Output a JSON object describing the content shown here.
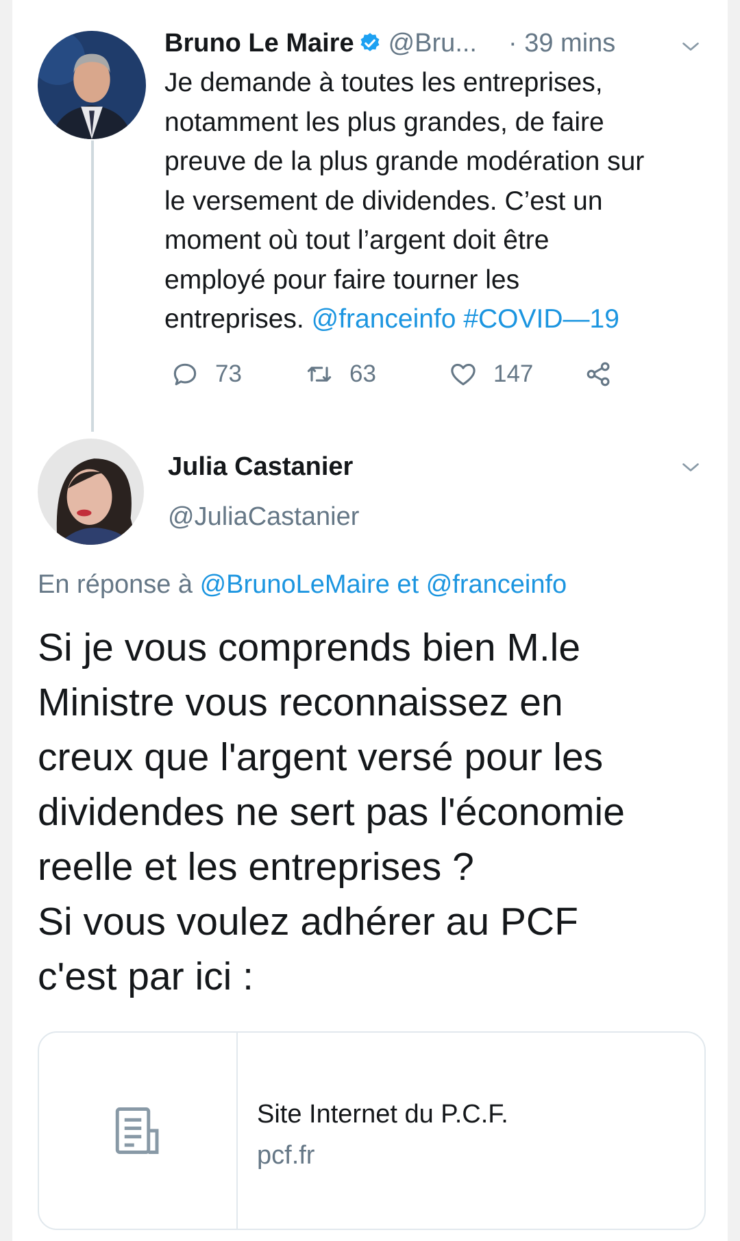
{
  "tweet1": {
    "author_name": "Bruno Le Maire",
    "author_handle": "@Bru...",
    "time": "· 39 mins",
    "body_lines": [
      "Je demande à toutes les entreprises,",
      "notamment les plus grandes, de faire",
      "preuve de la plus grande modération sur",
      "le versement de dividendes. C’est un",
      "moment où tout l’argent doit être",
      "employé pour faire tourner les"
    ],
    "body_last_text": "entreprises. ",
    "mention": "@franceinfo",
    "hashtag": "#COVID—19",
    "replies": "73",
    "retweets": "63",
    "likes": "147"
  },
  "tweet2": {
    "author_name": "Julia Castanier",
    "author_handle": "@JuliaCastanier",
    "reply_prefix": "En réponse à ",
    "reply_mention_1": "@BrunoLeMaire",
    "reply_joiner": " et ",
    "reply_mention_2": "@franceinfo",
    "body_lines": [
      "Si je vous comprends bien M.le",
      "Ministre vous reconnaissez en",
      "creux que l'argent versé pour les",
      "dividendes ne sert pas l'économie",
      "reelle et les entreprises ?",
      "Si vous voulez adhérer au PCF",
      "c'est par ici :"
    ]
  },
  "link_card": {
    "title": "Site Internet du P.C.F.",
    "domain": "pcf.fr"
  },
  "icons": {
    "verified": "verified-badge-icon",
    "reply": "reply-icon",
    "retweet": "retweet-icon",
    "like": "heart-icon",
    "share": "share-icon",
    "menu": "chevron-down-icon",
    "card": "document-icon"
  },
  "colors": {
    "link": "#1b95e0",
    "muted": "#657786",
    "text": "#14171a",
    "verified": "#1da1f2"
  }
}
